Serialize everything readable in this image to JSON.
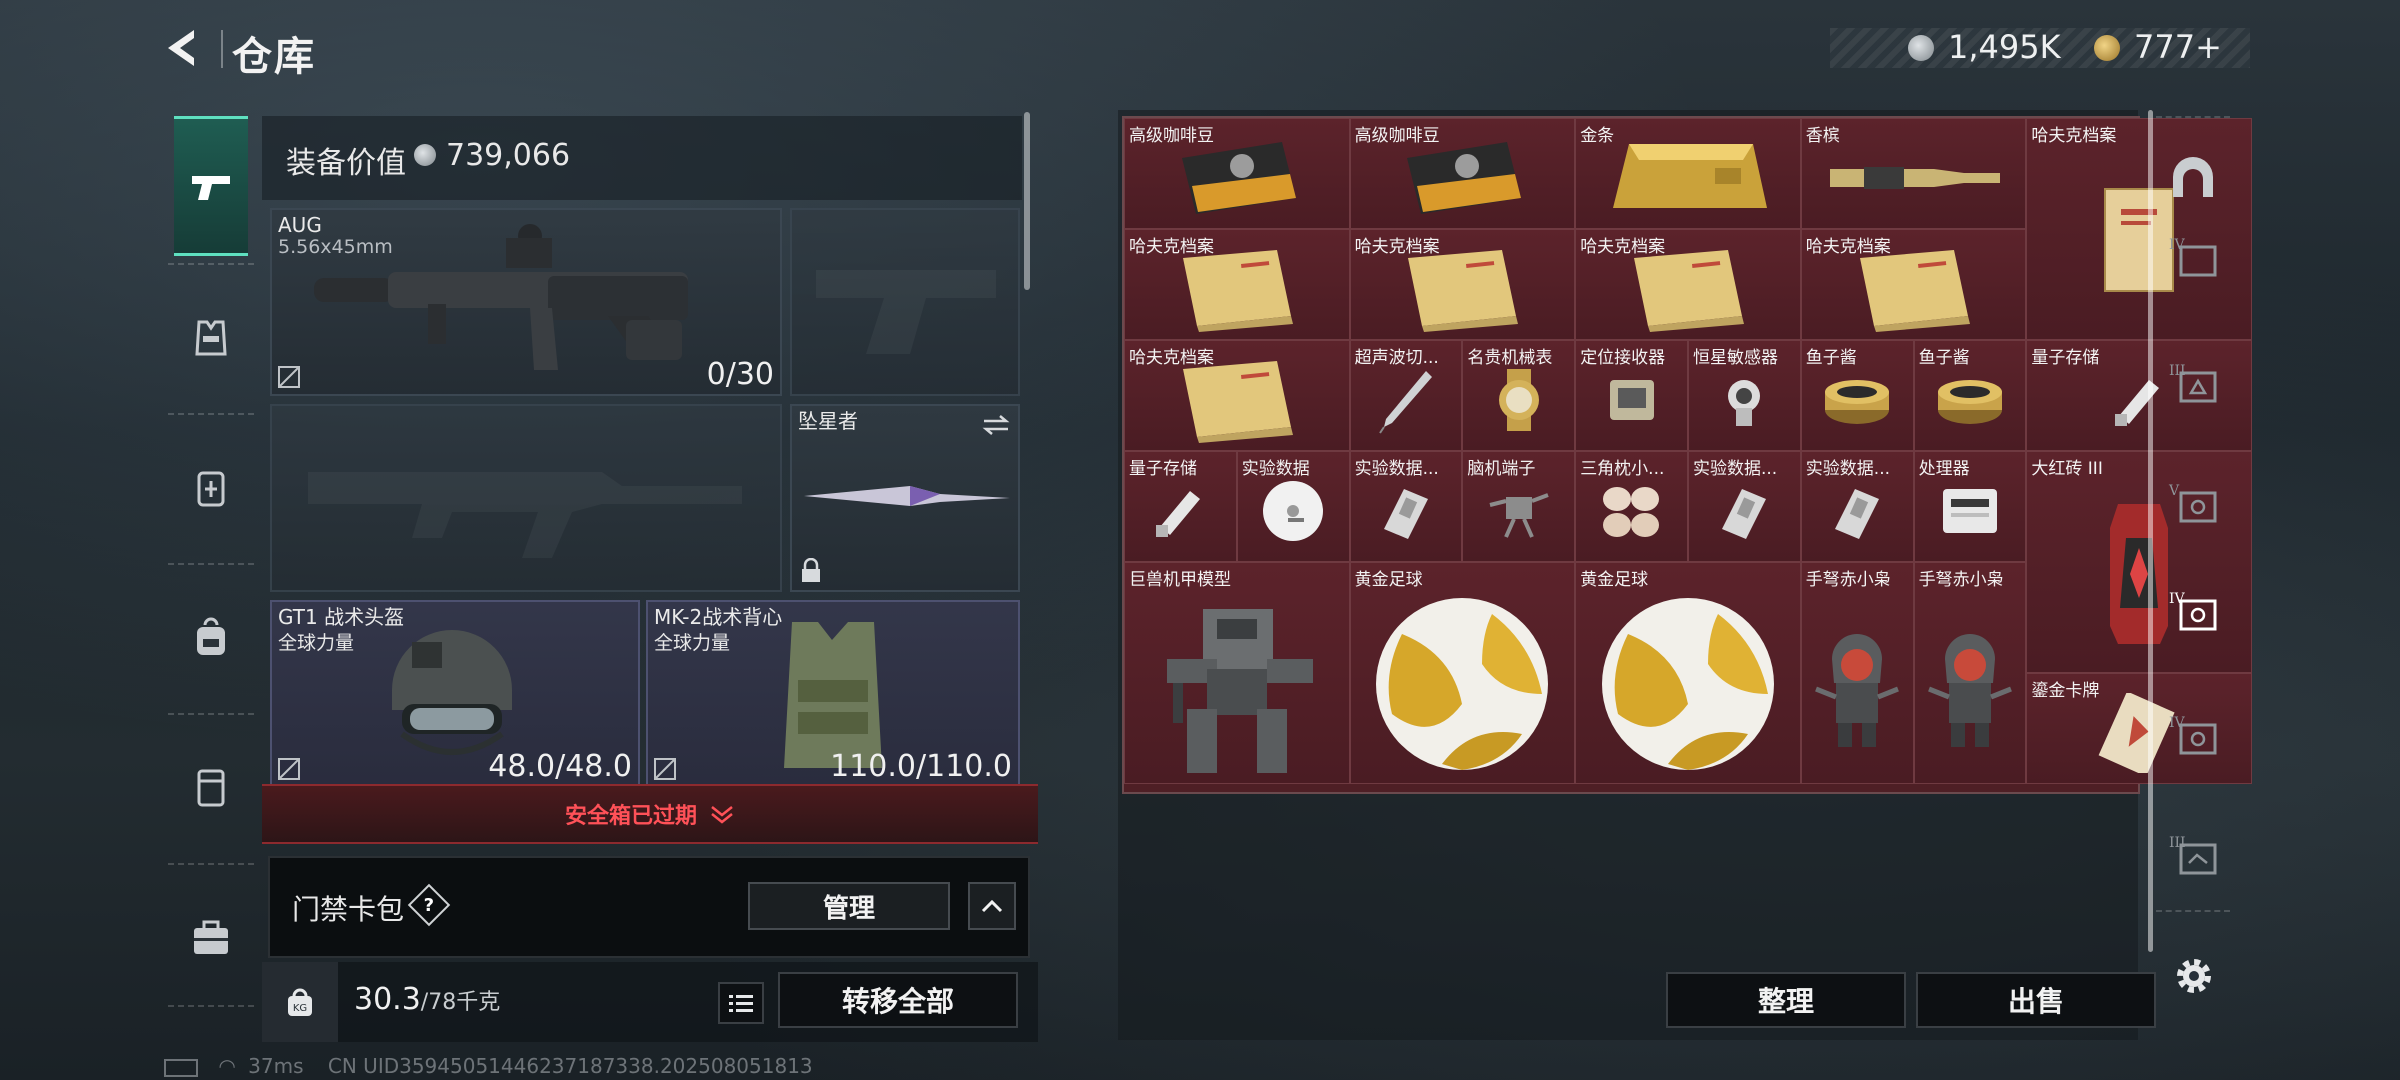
{
  "header": {
    "title": "仓库"
  },
  "currency": {
    "silver": "1,495K",
    "gold": "777+"
  },
  "loadout": {
    "value_label": "装备价值",
    "value": "739,066",
    "primary": {
      "name": "AUG",
      "caliber": "5.56x45mm",
      "ammo": "0/30"
    },
    "melee": {
      "name": "坠星者"
    },
    "helmet": {
      "name": "GT1 战术头盔",
      "tag": "全球力量",
      "durability": "48.0/48.0"
    },
    "vest": {
      "name": "MK-2战术背心",
      "tag": "全球力量",
      "durability": "110.0/110.0"
    },
    "safebox_status": "安全箱已过期",
    "keycard": {
      "label": "门禁卡包",
      "help": "?",
      "manage": "管理"
    },
    "weight": {
      "current": "30.3",
      "max": "/78千克"
    },
    "transfer_all": "转移全部"
  },
  "stash": {
    "sort": "整理",
    "sell": "出售",
    "items": [
      {
        "name": "高级咖啡豆",
        "art": "coffee"
      },
      {
        "name": "高级咖啡豆",
        "art": "coffee"
      },
      {
        "name": "金条",
        "art": "goldbar"
      },
      {
        "name": "香槟",
        "art": "champagne"
      },
      {
        "name": "哈夫克档案",
        "art": "file"
      },
      {
        "name": "哈夫克档案",
        "art": "folder"
      },
      {
        "name": "哈夫克档案",
        "art": "folder"
      },
      {
        "name": "哈夫克档案",
        "art": "folder"
      },
      {
        "name": "哈夫克档案",
        "art": "folder"
      },
      {
        "name": "哈夫克档案",
        "art": "folder"
      },
      {
        "name": "超声波切...",
        "art": "pen"
      },
      {
        "name": "名贵机械表",
        "art": "watch"
      },
      {
        "name": "定位接收器",
        "art": "device"
      },
      {
        "name": "恒星敏感器",
        "art": "sensor"
      },
      {
        "name": "鱼子酱",
        "art": "caviar"
      },
      {
        "name": "鱼子酱",
        "art": "caviar"
      },
      {
        "name": "量子存储",
        "art": "usb"
      },
      {
        "name": "量子存储",
        "art": "usb"
      },
      {
        "name": "实验数据",
        "art": "disc"
      },
      {
        "name": "实验数据...",
        "art": "drive"
      },
      {
        "name": "脑机端子",
        "art": "drone"
      },
      {
        "name": "三角枕小...",
        "art": "pillows"
      },
      {
        "name": "实验数据...",
        "art": "drive"
      },
      {
        "name": "实验数据...",
        "art": "drive"
      },
      {
        "name": "处理器",
        "art": "router"
      },
      {
        "name": "大红砖 III",
        "art": "redbrick"
      },
      {
        "name": "巨兽机甲模型",
        "art": "mech"
      },
      {
        "name": "黄金足球",
        "art": "ball"
      },
      {
        "name": "黄金足球",
        "art": "ball"
      },
      {
        "name": "手弩赤小枭",
        "art": "figure"
      },
      {
        "name": "手弩赤小枭",
        "art": "figure"
      },
      {
        "name": "鎏金卡牌",
        "art": "card"
      }
    ]
  },
  "status_bar": {
    "ping": "37ms",
    "uid": "CN UID35945051446237187338.202508051813"
  }
}
